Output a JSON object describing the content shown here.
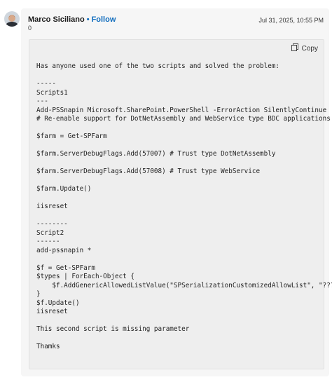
{
  "post": {
    "author": "Marco Siciliano",
    "separator": "•",
    "follow_label": "Follow",
    "reaction_count": "0",
    "timestamp": "Jul 31, 2025, 10:55 PM"
  },
  "code": {
    "copy_label": "Copy",
    "copy_icon": "copy-icon",
    "text": "Has anyone used one of the two scripts and solved the problem:\n\n-----\nScripts1\n---\nAdd-PSSnapin Microsoft.SharePoint.PowerShell -ErrorAction SilentlyContinue\n# Re-enable support for DotNetAssembly and WebService type BDC applications\n\n$farm = Get-SPFarm\n\n$farm.ServerDebugFlags.Add(57007) # Trust type DotNetAssembly\n\n$farm.ServerDebugFlags.Add(57008) # Trust type WebService\n\n$farm.Update()\n\niisreset\n\n--------\nScript2\n------\nadd-pssnapin *\n\n$f = Get-SPFarm\n$types | ForEach-Object {\n    $f.AddGenericAllowedListValue(\"SPSerializationCustomizedAllowList\", \"???\")\n}\n$f.Update()\niisreset\n\nThis second script is missing parameter\n\nThamks"
  }
}
